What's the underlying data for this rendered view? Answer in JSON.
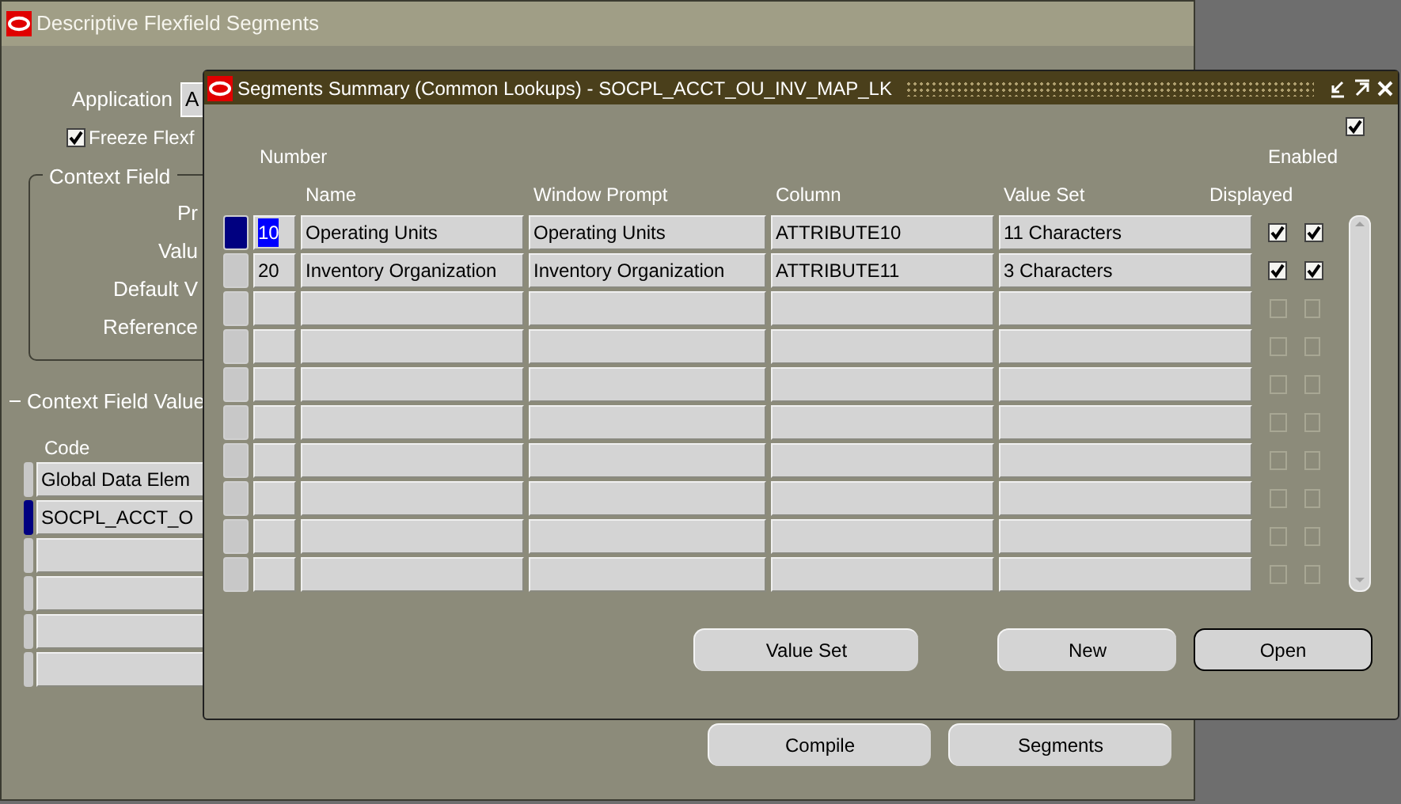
{
  "background_window": {
    "title": "Descriptive Flexfield Segments",
    "application": {
      "label": "Application",
      "value": "A"
    },
    "freeze": {
      "label": "Freeze Flexf",
      "checked": true
    },
    "context_field": {
      "title": "Context Field",
      "labels": [
        "Pr",
        "Valu",
        "Default V",
        "Reference"
      ]
    },
    "context_values": {
      "title": "Context Field Value",
      "column": "Code",
      "rows": [
        {
          "code": "Global Data Elem",
          "selected": false
        },
        {
          "code": "SOCPL_ACCT_O",
          "selected": true
        },
        {
          "selected": false
        },
        {
          "selected": false
        },
        {
          "selected": false
        },
        {
          "selected": false
        }
      ]
    },
    "buttons": [
      {
        "label": "Compile"
      },
      {
        "label": "Segments"
      }
    ]
  },
  "dialog": {
    "title": "Segments Summary (Common Lookups) - SOCPL_ACCT_OU_INV_MAP_LK",
    "top_checkbox": {
      "checked": true
    },
    "columns": {
      "number": "Number",
      "name": "Name",
      "prompt": "Window Prompt",
      "column": "Column",
      "value_set": "Value Set",
      "displayed": "Displayed",
      "enabled": "Enabled"
    },
    "rows": [
      {
        "number": "10",
        "name": "Operating Units",
        "prompt": "Operating Units",
        "column": "ATTRIBUTE10",
        "value_set": "11 Characters",
        "displayed": true,
        "enabled": true,
        "selected": true
      },
      {
        "number": "20",
        "name": "Inventory Organization",
        "prompt": "Inventory Organization",
        "column": "ATTRIBUTE11",
        "value_set": "3 Characters",
        "displayed": true,
        "enabled": true,
        "selected": false
      },
      {
        "displayed": false,
        "enabled": false,
        "selected": false
      },
      {
        "displayed": false,
        "enabled": false,
        "selected": false
      },
      {
        "displayed": false,
        "enabled": false,
        "selected": false
      },
      {
        "displayed": false,
        "enabled": false,
        "selected": false
      },
      {
        "displayed": false,
        "enabled": false,
        "selected": false
      },
      {
        "displayed": false,
        "enabled": false,
        "selected": false
      },
      {
        "displayed": false,
        "enabled": false,
        "selected": false
      },
      {
        "displayed": false,
        "enabled": false,
        "selected": false
      }
    ],
    "buttons": [
      {
        "label": "Value Set",
        "default": false
      },
      {
        "label": "New",
        "default": false
      },
      {
        "label": "Open",
        "default": true
      }
    ]
  }
}
